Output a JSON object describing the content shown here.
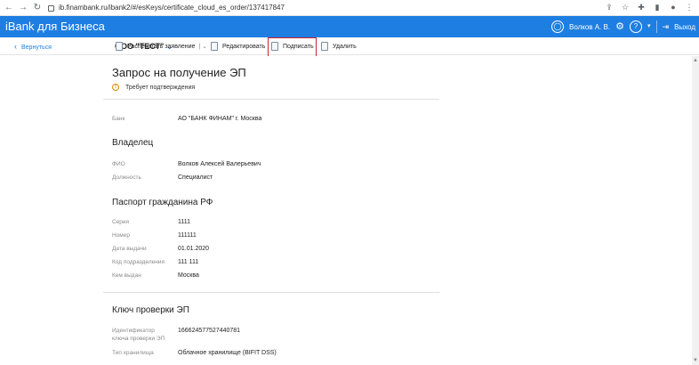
{
  "browser": {
    "url": "ib.finambank.ru/ibank2/#/esKeys/certificate_cloud_es_order/137417847"
  },
  "header": {
    "brand": "iBank для Бизнеса",
    "user": "Волков А. В.",
    "help": "?",
    "logout": "Выход"
  },
  "toolbar": {
    "back": "Вернуться",
    "org": "ООО \"ТЕСТ\"",
    "actions": [
      "Распечатать заявление",
      "Редактировать",
      "Подписать",
      "Удалить"
    ]
  },
  "page": {
    "title": "Запрос на получение ЭП",
    "status": "Требует подтверждения",
    "bank_label": "Банк",
    "bank_value": "АО \"БАНК ФИНАМ\" г. Москва"
  },
  "owner": {
    "title": "Владелец",
    "fio_label": "ФИО",
    "fio_value": "Волков Алексей Валерьевич",
    "position_label": "Должность",
    "position_value": "Специалист"
  },
  "passport": {
    "title": "Паспорт гражданина РФ",
    "series_label": "Серия",
    "series_value": "1111",
    "number_label": "Номер",
    "number_value": "111111",
    "date_label": "Дата выдачи",
    "date_value": "01.01.2020",
    "code_label": "Код подразделения",
    "code_value": "111 111",
    "issuer_label": "Кем выдан",
    "issuer_value": "Москва"
  },
  "key": {
    "title": "Ключ проверки ЭП",
    "id_label_1": "Идентификатор",
    "id_label_2": "ключа проверки ЭП",
    "id_value": "1666245775274407​81",
    "storage_label": "Тип хранилища",
    "storage_value": "Облачное хранилище (BIFIT DSS)"
  },
  "colors": {
    "accent": "#1e7ee2",
    "highlight": "#d0222a",
    "warning": "#e08a00"
  }
}
